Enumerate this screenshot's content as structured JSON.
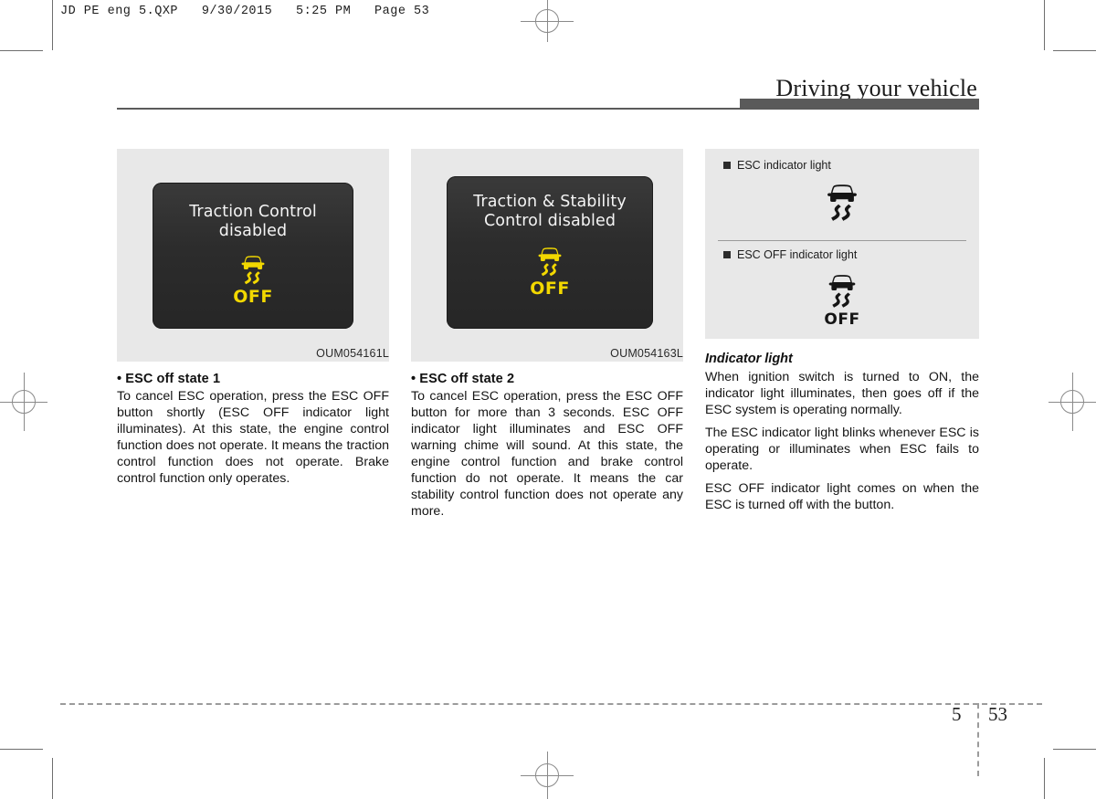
{
  "print_slug": "JD PE eng 5.QXP   9/30/2015   5:25 PM   Page 53",
  "header": {
    "running_title": "Driving your vehicle"
  },
  "figures": [
    {
      "name": "esc-off-state-1-figure",
      "lcd_message_lines": [
        "Traction Control",
        "disabled"
      ],
      "icon_label": "OFF",
      "icon_color": "#f2d800",
      "caption": "OUM054161L"
    },
    {
      "name": "esc-off-state-2-figure",
      "lcd_message_lines": [
        "Traction & Stability",
        "Control disabled"
      ],
      "icon_label": "OFF",
      "icon_color": "#f2d800",
      "caption": "OUM054163L"
    }
  ],
  "indicator_panel": {
    "items": [
      {
        "label": "ESC indicator light"
      },
      {
        "label": "ESC OFF indicator light",
        "icon_label": "OFF"
      }
    ]
  },
  "columns": [
    {
      "heading": "• ESC off state 1",
      "paragraphs": [
        "To cancel ESC operation, press the ESC OFF button shortly (ESC OFF indicator light illuminates). At this state, the engine control function does not operate. It means the traction control function does not operate. Brake control function only operates."
      ]
    },
    {
      "heading": "• ESC off state 2",
      "paragraphs": [
        "To cancel ESC operation, press the ESC OFF button for more than 3 seconds. ESC OFF indicator light illuminates and ESC OFF warning chime will sound. At this state, the engine control function and brake control function do not operate. It means the car stability control function does not operate any more."
      ]
    },
    {
      "heading": "Indicator light",
      "paragraphs": [
        "When ignition switch is turned to ON, the indicator light illuminates, then goes off if the ESC system is operating normally.",
        "The ESC indicator light blinks whenever ESC is operating or illuminates when ESC fails to operate.",
        "ESC OFF indicator light comes on when the ESC is turned off with the button."
      ]
    }
  ],
  "footer": {
    "chapter": "5",
    "page": "53"
  }
}
